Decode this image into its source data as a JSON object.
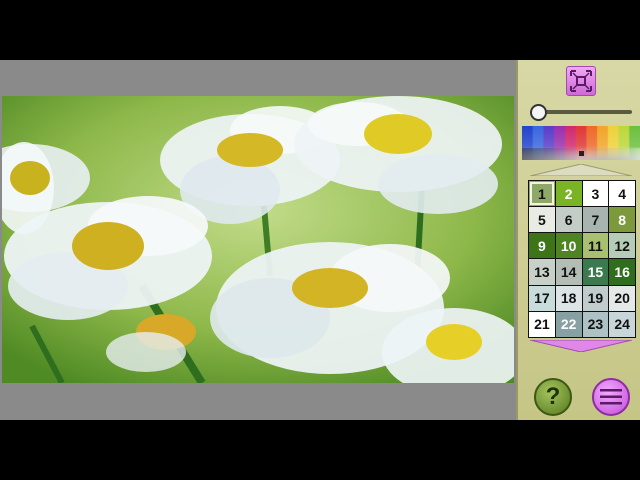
{
  "colors": {
    "panel_bg": "#d4d49e",
    "canvas_gray": "#8a8a8a",
    "accent_pink": "#e08ae8",
    "accent_green": "#7a9a34"
  },
  "toolbar": {
    "fit_icon": "fit-to-screen-icon",
    "zoom_level": 0.0
  },
  "palette": [
    "#2244cc",
    "#3a66e0",
    "#5a3ec8",
    "#9a30b0",
    "#d02a6e",
    "#e03838",
    "#ee6a2a",
    "#f2a52a",
    "#eed23a",
    "#bcd83a",
    "#6cc040"
  ],
  "number_grid": {
    "selected": "1",
    "cells": [
      {
        "label": "1",
        "bg": "#8ea86a",
        "fg": "#111111"
      },
      {
        "label": "2",
        "bg": "#7ab424",
        "fg": "#ffffff"
      },
      {
        "label": "3",
        "bg": "#ffffff",
        "fg": "#111111"
      },
      {
        "label": "4",
        "bg": "#ffffff",
        "fg": "#111111"
      },
      {
        "label": "5",
        "bg": "#e8ece4",
        "fg": "#111111"
      },
      {
        "label": "6",
        "bg": "#c4ccc8",
        "fg": "#111111"
      },
      {
        "label": "7",
        "bg": "#a8b4b0",
        "fg": "#111111"
      },
      {
        "label": "8",
        "bg": "#7c9a3c",
        "fg": "#ffffff"
      },
      {
        "label": "9",
        "bg": "#3e7418",
        "fg": "#ffffff"
      },
      {
        "label": "10",
        "bg": "#4e8422",
        "fg": "#ffffff"
      },
      {
        "label": "11",
        "bg": "#a8c070",
        "fg": "#111111"
      },
      {
        "label": "12",
        "bg": "#b6ccb8",
        "fg": "#111111"
      },
      {
        "label": "13",
        "bg": "#c8d0ca",
        "fg": "#111111"
      },
      {
        "label": "14",
        "bg": "#b4bcb6",
        "fg": "#111111"
      },
      {
        "label": "15",
        "bg": "#3a7a4e",
        "fg": "#ffffff"
      },
      {
        "label": "16",
        "bg": "#2e6e1c",
        "fg": "#ffffff"
      },
      {
        "label": "17",
        "bg": "#c8dcdc",
        "fg": "#111111"
      },
      {
        "label": "18",
        "bg": "#dce4e6",
        "fg": "#111111"
      },
      {
        "label": "19",
        "bg": "#c2cccc",
        "fg": "#111111"
      },
      {
        "label": "20",
        "bg": "#e4e8e6",
        "fg": "#111111"
      },
      {
        "label": "21",
        "bg": "#ffffff",
        "fg": "#111111"
      },
      {
        "label": "22",
        "bg": "#86a0a4",
        "fg": "#ffffff"
      },
      {
        "label": "23",
        "bg": "#aec2c6",
        "fg": "#111111"
      },
      {
        "label": "24",
        "bg": "#c8d6da",
        "fg": "#111111"
      }
    ]
  },
  "buttons": {
    "help_label": "?",
    "menu_icon": "hamburger-menu-icon"
  }
}
